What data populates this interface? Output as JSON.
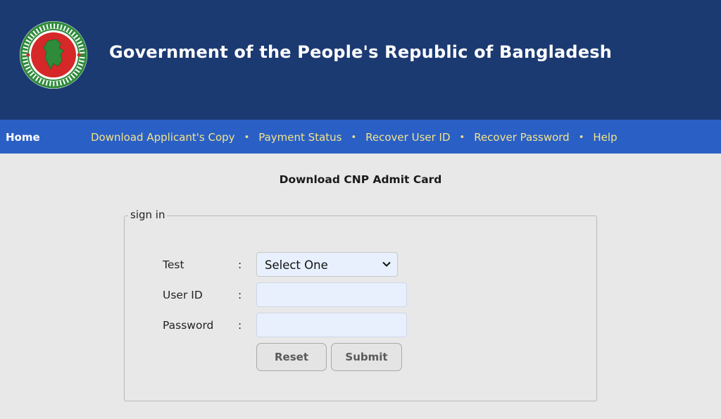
{
  "header": {
    "title": "Government of the People's Republic of Bangladesh",
    "seal": {
      "icon": "government-seal-icon",
      "ring_color": "#2e8b3a",
      "disc_color": "#d62828"
    },
    "background_color": "#1c3a72"
  },
  "nav": {
    "home": "Home",
    "items": [
      {
        "label": "Download Applicant's Copy"
      },
      {
        "label": "Payment Status"
      },
      {
        "label": "Recover User ID"
      },
      {
        "label": "Recover Password"
      },
      {
        "label": "Help"
      }
    ],
    "separator": "•",
    "background_color": "#2a60c6",
    "link_color": "#f3e28a"
  },
  "main": {
    "heading": "Download CNP Admit Card",
    "form": {
      "legend": "sign in",
      "fields": {
        "test": {
          "label": "Test",
          "colon": ":",
          "value": "Select One",
          "icon": "chevron-down-icon"
        },
        "user_id": {
          "label": "User ID",
          "colon": ":",
          "value": ""
        },
        "password": {
          "label": "Password",
          "colon": ":",
          "value": ""
        }
      },
      "buttons": {
        "reset": "Reset",
        "submit": "Submit"
      }
    }
  }
}
